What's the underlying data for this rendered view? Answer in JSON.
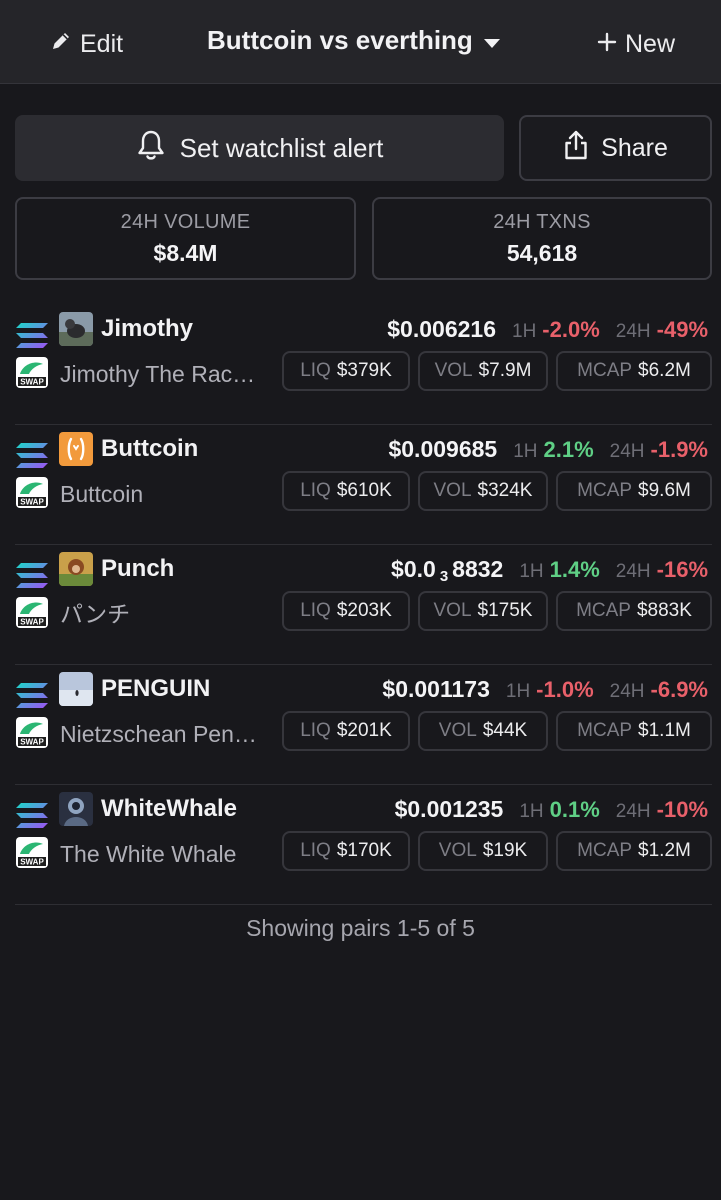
{
  "header": {
    "edit_label": "Edit",
    "title": "Buttcoin vs everthing",
    "new_label": "New"
  },
  "actions": {
    "alert_label": "Set watchlist alert",
    "share_label": "Share"
  },
  "stats": {
    "volume_label": "24H VOLUME",
    "volume_value": "$8.4M",
    "txns_label": "24H TXNS",
    "txns_value": "54,618"
  },
  "pairs": [
    {
      "symbol": "Jimothy",
      "name": "Jimothy The Rac…",
      "price": "$0.006216",
      "h1_label": "1H",
      "h1_change": "-2.0%",
      "h1_dir": "neg",
      "h24_label": "24H",
      "h24_change": "-49%",
      "h24_dir": "neg",
      "liq_label": "LIQ",
      "liq": "$379K",
      "vol_label": "VOL",
      "vol": "$7.9M",
      "mcap_label": "MCAP",
      "mcap": "$6.2M"
    },
    {
      "symbol": "Buttcoin",
      "name": "Buttcoin",
      "price": "$0.009685",
      "h1_label": "1H",
      "h1_change": "2.1%",
      "h1_dir": "pos",
      "h24_label": "24H",
      "h24_change": "-1.9%",
      "h24_dir": "neg",
      "liq_label": "LIQ",
      "liq": "$610K",
      "vol_label": "VOL",
      "vol": "$324K",
      "mcap_label": "MCAP",
      "mcap": "$9.6M"
    },
    {
      "symbol": "Punch",
      "name": "パンチ",
      "price_prefix": "$0.0",
      "price_zeros": "3",
      "price_suffix": "8832",
      "h1_label": "1H",
      "h1_change": "1.4%",
      "h1_dir": "pos",
      "h24_label": "24H",
      "h24_change": "-16%",
      "h24_dir": "neg",
      "liq_label": "LIQ",
      "liq": "$203K",
      "vol_label": "VOL",
      "vol": "$175K",
      "mcap_label": "MCAP",
      "mcap": "$883K"
    },
    {
      "symbol": "PENGUIN",
      "name": "Nietzschean Pen…",
      "price": "$0.001173",
      "h1_label": "1H",
      "h1_change": "-1.0%",
      "h1_dir": "neg",
      "h24_label": "24H",
      "h24_change": "-6.9%",
      "h24_dir": "neg",
      "liq_label": "LIQ",
      "liq": "$201K",
      "vol_label": "VOL",
      "vol": "$44K",
      "mcap_label": "MCAP",
      "mcap": "$1.1M"
    },
    {
      "symbol": "WhiteWhale",
      "name": "The White Whale",
      "price": "$0.001235",
      "h1_label": "1H",
      "h1_change": "0.1%",
      "h1_dir": "pos",
      "h24_label": "24H",
      "h24_change": "-10%",
      "h24_dir": "neg",
      "liq_label": "LIQ",
      "liq": "$170K",
      "vol_label": "VOL",
      "vol": "$19K",
      "mcap_label": "MCAP",
      "mcap": "$1.2M"
    }
  ],
  "footer": {
    "label": "Showing pairs 1-5 of 5"
  },
  "colors": {
    "negative": "#e8606a",
    "positive": "#5fcf85",
    "background": "#18181c"
  },
  "icons": {
    "chain": "solana-icon",
    "dex": "swap-icon",
    "alert": "bell-icon",
    "share": "share-icon",
    "edit": "pencil-icon",
    "new": "plus-icon",
    "title_menu": "caret-down-icon"
  }
}
